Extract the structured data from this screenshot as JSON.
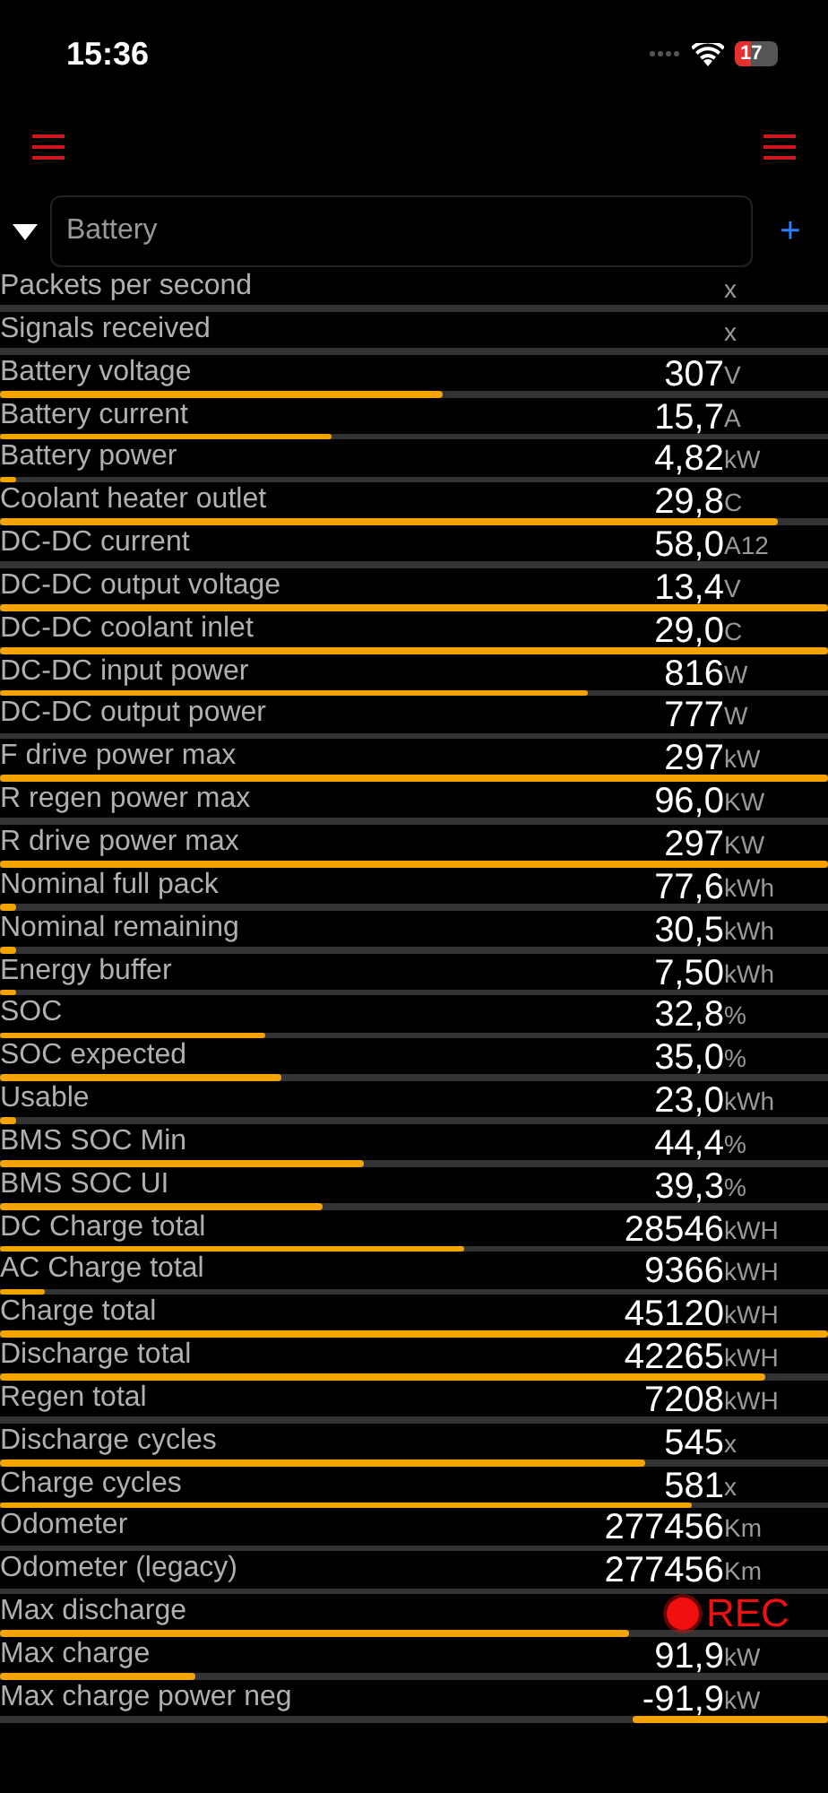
{
  "status_bar": {
    "time": "15:36",
    "battery": "17"
  },
  "selector": {
    "value": "Battery",
    "expanded": true,
    "add_label": "+"
  },
  "signals": [
    {
      "label": "Packets per second",
      "unit": "x",
      "kind": "bar"
    },
    {
      "label": "Signals received",
      "unit": "x",
      "kind": "bar"
    },
    {
      "label": "Battery voltage",
      "value": "307",
      "unit": "V",
      "level": 0.535,
      "kind": "bar"
    },
    {
      "label": "Battery current",
      "value": "15,7",
      "unit": "A",
      "level": 0.4,
      "kind": "bar"
    },
    {
      "label": "Battery power",
      "value": "4,82",
      "unit": "kW",
      "level": 0.02,
      "kind": "bar"
    },
    {
      "label": "Coolant heater outlet",
      "value": "29,8",
      "unit": "C",
      "level": 0.94,
      "kind": "bar"
    },
    {
      "label": "DC-DC current",
      "value": "58,0",
      "unit": "A12",
      "kind": "bar"
    },
    {
      "label": "DC-DC output voltage",
      "value": "13,4",
      "unit": "V",
      "level": 1,
      "kind": "bar"
    },
    {
      "label": "DC-DC coolant inlet",
      "value": "29,0",
      "unit": "C",
      "level": 1,
      "kind": "bar"
    },
    {
      "label": "DC-DC input power",
      "value": "816",
      "unit": "W",
      "level": 0.71,
      "kind": "bar"
    },
    {
      "label": "DC-DC output power",
      "value": "777",
      "unit": "W",
      "kind": "bar"
    },
    {
      "label": "F drive power max",
      "value": "297",
      "unit": "kW",
      "level": 1,
      "kind": "bar"
    },
    {
      "label": "R regen power max",
      "value": "96,0",
      "unit": "KW",
      "kind": "bar"
    },
    {
      "label": "R drive power max",
      "value": "297",
      "unit": "KW",
      "level": 1,
      "kind": "bar"
    },
    {
      "label": "Nominal full pack",
      "value": "77,6",
      "unit": "kWh",
      "level": 0.02,
      "kind": "bar"
    },
    {
      "label": "Nominal remaining",
      "value": "30,5",
      "unit": "kWh",
      "level": 0.02,
      "kind": "bar"
    },
    {
      "label": "Energy buffer",
      "value": "7,50",
      "unit": "kWh",
      "level": 0.02,
      "kind": "bar"
    },
    {
      "label": "SOC",
      "value": "32,8",
      "unit": "%",
      "level": 0.32,
      "kind": "bar"
    },
    {
      "label": "SOC expected",
      "value": "35,0",
      "unit": "%",
      "level": 0.34,
      "kind": "bar"
    },
    {
      "label": "Usable",
      "value": "23,0",
      "unit": "kWh",
      "level": 0.02,
      "kind": "bar"
    },
    {
      "label": "BMS SOC Min",
      "value": "44,4",
      "unit": "%",
      "level": 0.44,
      "kind": "bar"
    },
    {
      "label": "BMS SOC UI",
      "value": "39,3",
      "unit": "%",
      "level": 0.39,
      "kind": "bar"
    },
    {
      "label": "DC Charge total",
      "value": "28546",
      "unit": "kWH",
      "level": 0.56,
      "kind": "bar"
    },
    {
      "label": "AC Charge total",
      "value": "9366",
      "unit": "kWH",
      "level": 0.055,
      "kind": "bar"
    },
    {
      "label": "Charge total",
      "value": "45120",
      "unit": "kWH",
      "level": 1,
      "kind": "bar"
    },
    {
      "label": "Discharge total",
      "value": "42265",
      "unit": "kWH",
      "level": 0.925,
      "kind": "bar"
    },
    {
      "label": "Regen total",
      "value": "7208",
      "unit": "kWH",
      "kind": "bar"
    },
    {
      "label": "Discharge cycles",
      "value": "545",
      "unit": "x",
      "level": 0.78,
      "kind": "bar"
    },
    {
      "label": "Charge cycles",
      "value": "581",
      "unit": "x",
      "level": 0.835,
      "kind": "bar"
    },
    {
      "label": "Odometer",
      "value": "277456",
      "unit": "Km",
      "kind": "bar"
    },
    {
      "label": "Odometer (legacy)",
      "value": "277456",
      "unit": "Km",
      "kind": "bar"
    },
    {
      "label": "Max discharge",
      "level": 0.76,
      "kind": "bar"
    },
    {
      "label": "Max charge",
      "value": "91,9",
      "unit": "kW",
      "level": 0.235,
      "kind": "bar"
    },
    {
      "label": "Max charge power neg",
      "value": "-91,9",
      "unit": "kW",
      "level": 0.235,
      "kind": "reverse-bar"
    }
  ],
  "recording": {
    "label": "REC"
  }
}
